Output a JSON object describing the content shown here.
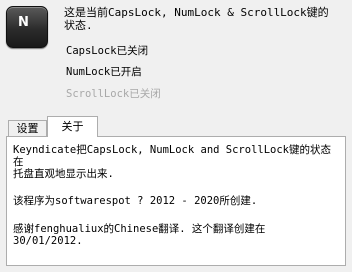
{
  "app": {
    "icon_name": "keyboard-key-icon",
    "icon_letter": "N",
    "header_text": "这是当前CapsLock, NumLock & ScrollLock键的\n状态."
  },
  "status": {
    "capslock": "CapsLock已关闭",
    "numlock": "NumLock已开启",
    "scrolllock": "ScrollLock已关闭"
  },
  "tabs": {
    "settings_label": "设置",
    "about_label": "关于",
    "active": "about"
  },
  "about": {
    "description": "Keyndicate把CapsLock, NumLock and ScrollLock键的状态在\n托盘直观地显示出来.",
    "created": "该程序为softwarespot ? 2012 - 2020所创建.",
    "translation": "感谢fenghualiux的Chinese翻译. 这个翻译创建在\n30/01/2012."
  },
  "colors": {
    "window_bg": "#f0f0f0",
    "panel_bg": "#ffffff",
    "disabled_text": "#a8a8a8",
    "border": "#adadad"
  }
}
